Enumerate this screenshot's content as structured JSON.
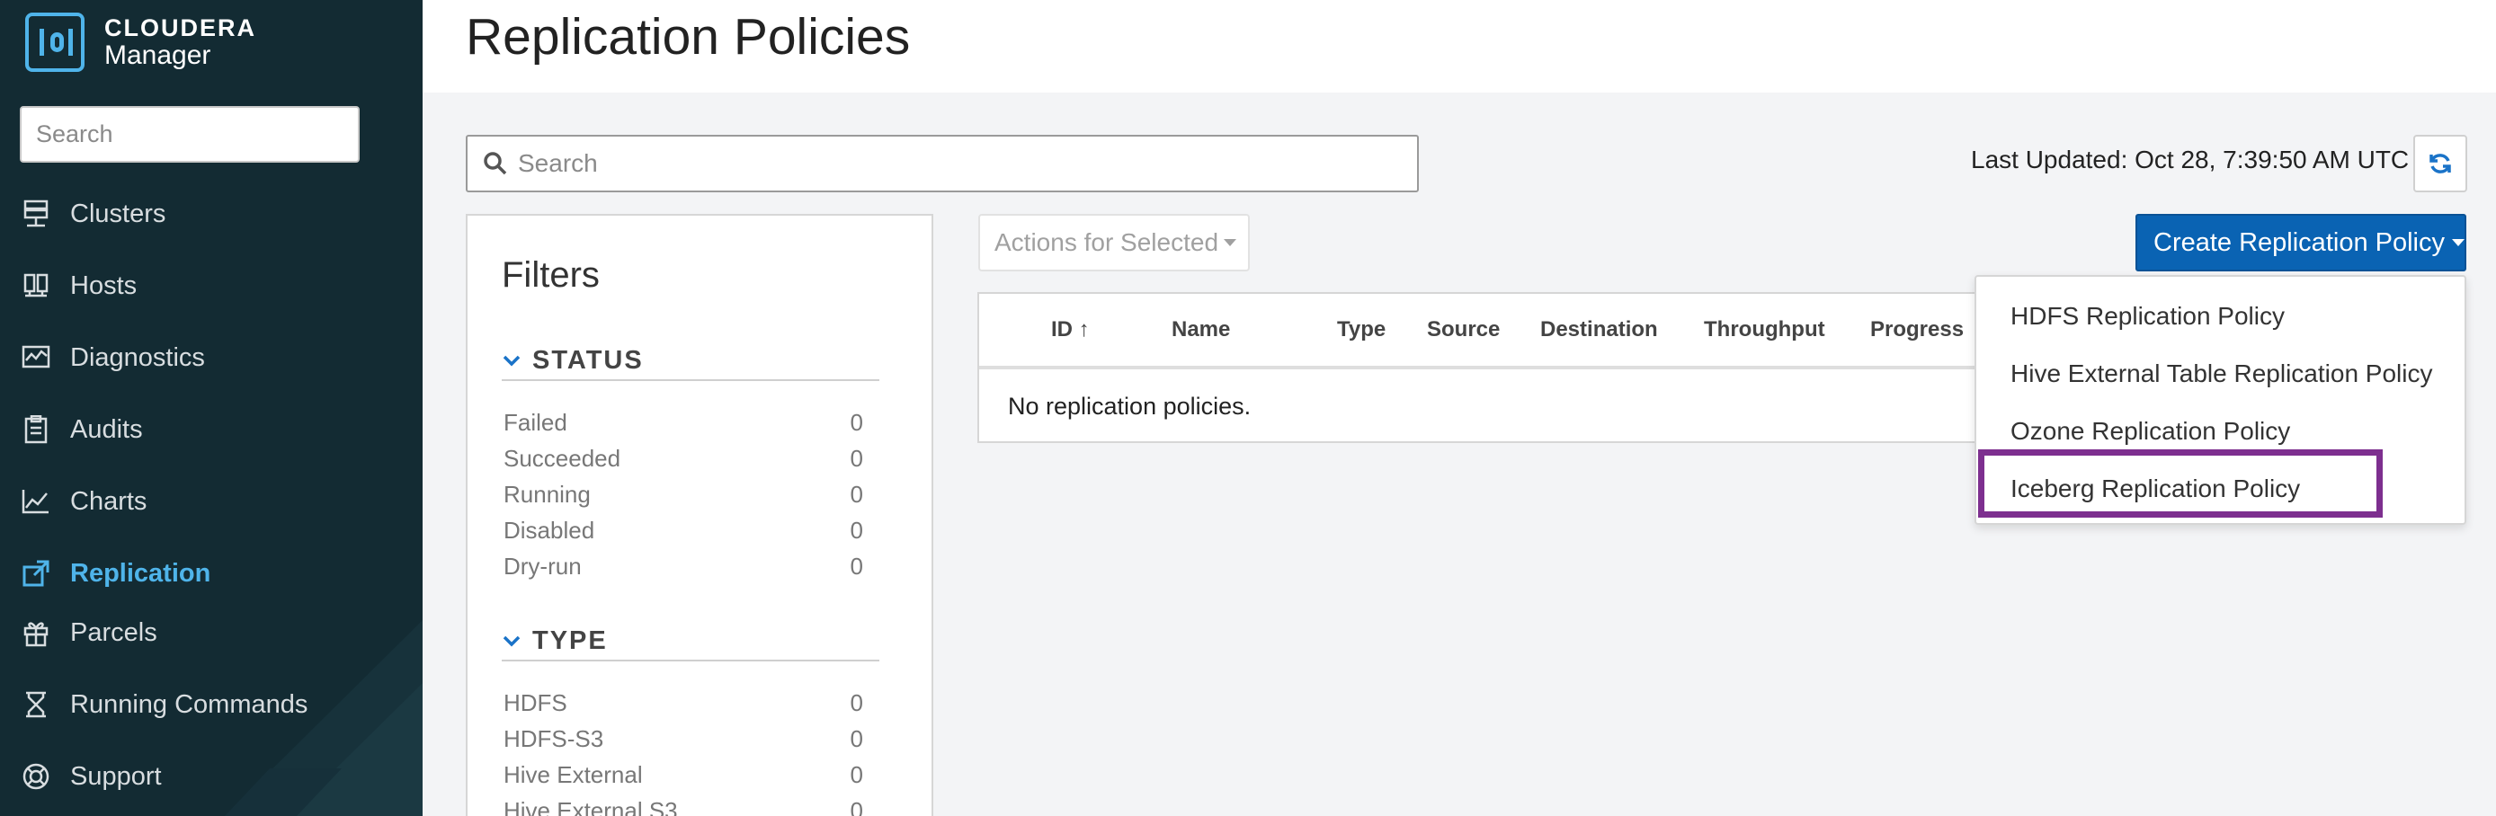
{
  "app": {
    "brand": "CLOUDERA",
    "product": "Manager"
  },
  "sidebar": {
    "search_placeholder": "Search",
    "items": [
      {
        "label": "Clusters",
        "icon": "clusters-icon"
      },
      {
        "label": "Hosts",
        "icon": "hosts-icon"
      },
      {
        "label": "Diagnostics",
        "icon": "diagnostics-icon"
      },
      {
        "label": "Audits",
        "icon": "audits-icon"
      },
      {
        "label": "Charts",
        "icon": "charts-icon"
      },
      {
        "label": "Replication",
        "icon": "replication-icon",
        "active": true
      },
      {
        "label": "Parcels",
        "icon": "parcels-icon"
      },
      {
        "label": "Running Commands",
        "icon": "hourglass-icon"
      },
      {
        "label": "Support",
        "icon": "lifebuoy-icon"
      }
    ]
  },
  "page": {
    "title": "Replication Policies",
    "search_placeholder": "Search",
    "last_updated": "Last Updated: Oct 28, 7:39:50 AM UTC"
  },
  "filters": {
    "title": "Filters",
    "status": {
      "heading": "STATUS",
      "rows": [
        {
          "label": "Failed",
          "count": "0"
        },
        {
          "label": "Succeeded",
          "count": "0"
        },
        {
          "label": "Running",
          "count": "0"
        },
        {
          "label": "Disabled",
          "count": "0"
        },
        {
          "label": "Dry-run",
          "count": "0"
        }
      ]
    },
    "type": {
      "heading": "TYPE",
      "rows": [
        {
          "label": "HDFS",
          "count": "0"
        },
        {
          "label": "HDFS-S3",
          "count": "0"
        },
        {
          "label": "Hive External",
          "count": "0"
        },
        {
          "label": "Hive External S3",
          "count": "0"
        }
      ]
    }
  },
  "toolbar": {
    "actions_label": "Actions for Selected",
    "create_label": "Create Replication Policy"
  },
  "table": {
    "columns": [
      "ID ↑",
      "Name",
      "Type",
      "Source",
      "Destination",
      "Throughput",
      "Progress"
    ],
    "empty_message": "No replication policies."
  },
  "create_menu": {
    "items": [
      "HDFS Replication Policy",
      "Hive External Table Replication Policy",
      "Ozone Replication Policy",
      "Iceberg Replication Policy"
    ],
    "highlighted_index": 3
  },
  "colors": {
    "sidebar_bg": "#132b33",
    "accent": "#4fb4ea",
    "primary_button": "#0a63b3",
    "highlight_border": "#7d2f8f"
  }
}
